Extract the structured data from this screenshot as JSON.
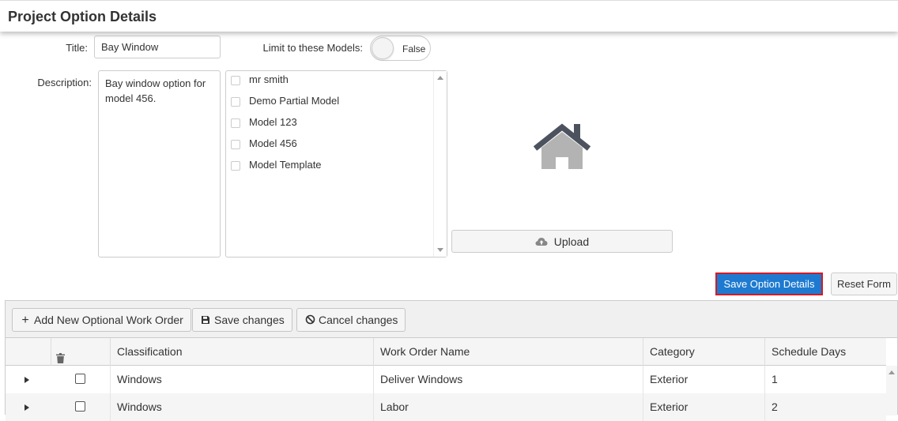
{
  "header": {
    "title": "Project Option Details"
  },
  "form": {
    "title_label": "Title:",
    "title_value": "Bay Window",
    "limit_label": "Limit to these Models:",
    "limit_toggle_value": "False",
    "description_label": "Description:",
    "description_value": "Bay window option for model 456.",
    "models": [
      {
        "label": "mr smith",
        "checked": false
      },
      {
        "label": "Demo Partial Model",
        "checked": false
      },
      {
        "label": "Model 123",
        "checked": false
      },
      {
        "label": "Model 456",
        "checked": false
      },
      {
        "label": "Model Template",
        "checked": false
      }
    ],
    "upload_label": "Upload",
    "save_label": "Save Option Details",
    "reset_label": "Reset Form"
  },
  "grid": {
    "toolbar": {
      "add_label": "Add New Optional Work Order",
      "save_label": "Save changes",
      "cancel_label": "Cancel changes"
    },
    "columns": [
      "Classification",
      "Work Order Name",
      "Category",
      "Schedule Days"
    ],
    "rows": [
      {
        "classification": "Windows",
        "work_order_name": "Deliver Windows",
        "category": "Exterior",
        "schedule_days": "1"
      },
      {
        "classification": "Windows",
        "work_order_name": "Labor",
        "category": "Exterior",
        "schedule_days": "2"
      }
    ]
  },
  "colors": {
    "primary": "#1a74c9",
    "highlight_border": "#d51923",
    "house_roof": "#4d535e",
    "house_body": "#b3b3b3"
  }
}
